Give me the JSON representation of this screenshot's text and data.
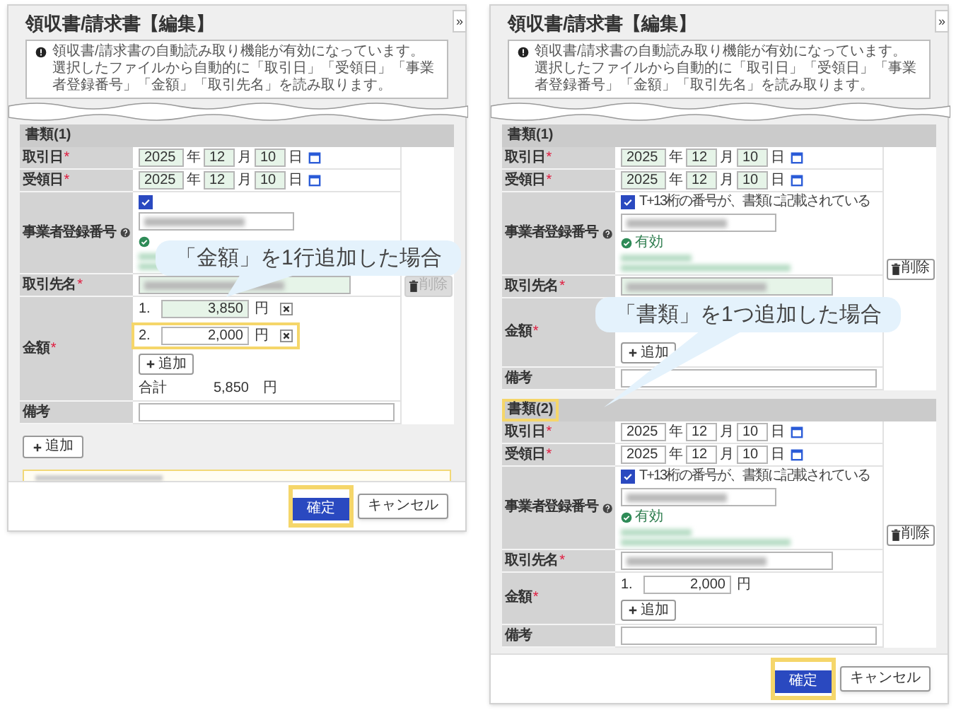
{
  "panels": [
    {
      "title": "領収書/請求書【編集】",
      "collapse_button": "»",
      "notice": {
        "line_1": "領収書/請求書の自動読み取り機能が有効になっています。",
        "line_2": "選択したファイルから自動的に「取引日」「受領日」「事業者登録番号」「金額」「取引先名」を読み取ります。"
      },
      "documents": [
        {
          "heading": "書類(1)",
          "highlighted": false,
          "delete_button": {
            "label": "削除",
            "disabled": true
          },
          "fields": [
            {
              "kind": "date",
              "label": "取引日",
              "required_mark": "*",
              "autofilled": true,
              "year": "2025",
              "year_unit": "年",
              "month": "12",
              "month_unit": "月",
              "day": "10",
              "day_unit": "日"
            },
            {
              "kind": "date",
              "label": "受領日",
              "required_mark": "*",
              "autofilled": true,
              "year": "2025",
              "year_unit": "年",
              "month": "12",
              "month_unit": "月",
              "day": "10",
              "day_unit": "日"
            },
            {
              "kind": "registration",
              "label": "事業者登録番号",
              "checked": true,
              "autofilled": false,
              "valid": true
            },
            {
              "kind": "text",
              "label": "取引先名",
              "required_mark": "*",
              "autofilled": true
            },
            {
              "kind": "amount",
              "label": "金額",
              "required_mark": "*",
              "rows": [
                {
                  "index": "1.",
                  "value": "3,850",
                  "unit": "円",
                  "autofilled": true,
                  "highlighted": false,
                  "remove_button": true
                },
                {
                  "index": "2.",
                  "value": "2,000",
                  "unit": "円",
                  "autofilled": false,
                  "highlighted": true,
                  "remove_button": true
                }
              ],
              "add_button": "追加",
              "total": {
                "label": "合計",
                "value": "5,850",
                "unit": "円"
              }
            },
            {
              "kind": "note",
              "label": "備考"
            }
          ]
        }
      ],
      "add_document_button": "追加",
      "cut_notice": true,
      "footer": {
        "confirm": "確定",
        "confirm_highlighted": true,
        "cancel": "キャンセル"
      },
      "callout": "「金額」を1行追加した場合"
    },
    {
      "title": "領収書/請求書【編集】",
      "collapse_button": "»",
      "notice": {
        "line_1": "領収書/請求書の自動読み取り機能が有効になっています。",
        "line_2": "選択したファイルから自動的に「取引日」「受領日」「事業者登録番号」「金額」「取引先名」を読み取ります。"
      },
      "documents": [
        {
          "heading": "書類(1)",
          "highlighted": false,
          "delete_button": {
            "label": "削除",
            "disabled": false
          },
          "fields": [
            {
              "kind": "date",
              "label": "取引日",
              "required_mark": "*",
              "autofilled": true,
              "year": "2025",
              "year_unit": "年",
              "month": "12",
              "month_unit": "月",
              "day": "10",
              "day_unit": "日"
            },
            {
              "kind": "date",
              "label": "受領日",
              "required_mark": "*",
              "autofilled": true,
              "year": "2025",
              "year_unit": "年",
              "month": "12",
              "month_unit": "月",
              "day": "10",
              "day_unit": "日"
            },
            {
              "kind": "registration",
              "label": "事業者登録番号",
              "checked": true,
              "checkbox_label": "T+13桁の番号が、書類に記載されている",
              "autofilled": false,
              "valid": true,
              "status": "有効"
            },
            {
              "kind": "text",
              "label": "取引先名",
              "required_mark": "*",
              "autofilled": true
            },
            {
              "kind": "amount",
              "label": "金額",
              "required_mark": "*",
              "add_button": "追加"
            },
            {
              "kind": "note",
              "label": "備考"
            }
          ]
        },
        {
          "heading": "書類(2)",
          "highlighted": true,
          "delete_button": {
            "label": "削除",
            "disabled": false
          },
          "fields": [
            {
              "kind": "date",
              "label": "取引日",
              "required_mark": "*",
              "autofilled": false,
              "year": "2025",
              "year_unit": "年",
              "month": "12",
              "month_unit": "月",
              "day": "10",
              "day_unit": "日"
            },
            {
              "kind": "date",
              "label": "受領日",
              "required_mark": "*",
              "autofilled": false,
              "year": "2025",
              "year_unit": "年",
              "month": "12",
              "month_unit": "月",
              "day": "10",
              "day_unit": "日"
            },
            {
              "kind": "registration",
              "label": "事業者登録番号",
              "checked": true,
              "checkbox_label": "T+13桁の番号が、書類に記載されている",
              "autofilled": false,
              "valid": true,
              "status": "有効"
            },
            {
              "kind": "text",
              "label": "取引先名",
              "required_mark": "*",
              "autofilled": false
            },
            {
              "kind": "amount",
              "label": "金額",
              "required_mark": "*",
              "rows": [
                {
                  "index": "1.",
                  "value": "2,000",
                  "unit": "円",
                  "autofilled": false,
                  "highlighted": false,
                  "remove_button": false
                }
              ],
              "add_button": "追加"
            },
            {
              "kind": "note",
              "label": "備考"
            }
          ]
        }
      ],
      "footer": {
        "confirm": "確定",
        "confirm_highlighted": true,
        "cancel": "キャンセル"
      },
      "callout": "「書類」を1つ追加した場合"
    }
  ]
}
